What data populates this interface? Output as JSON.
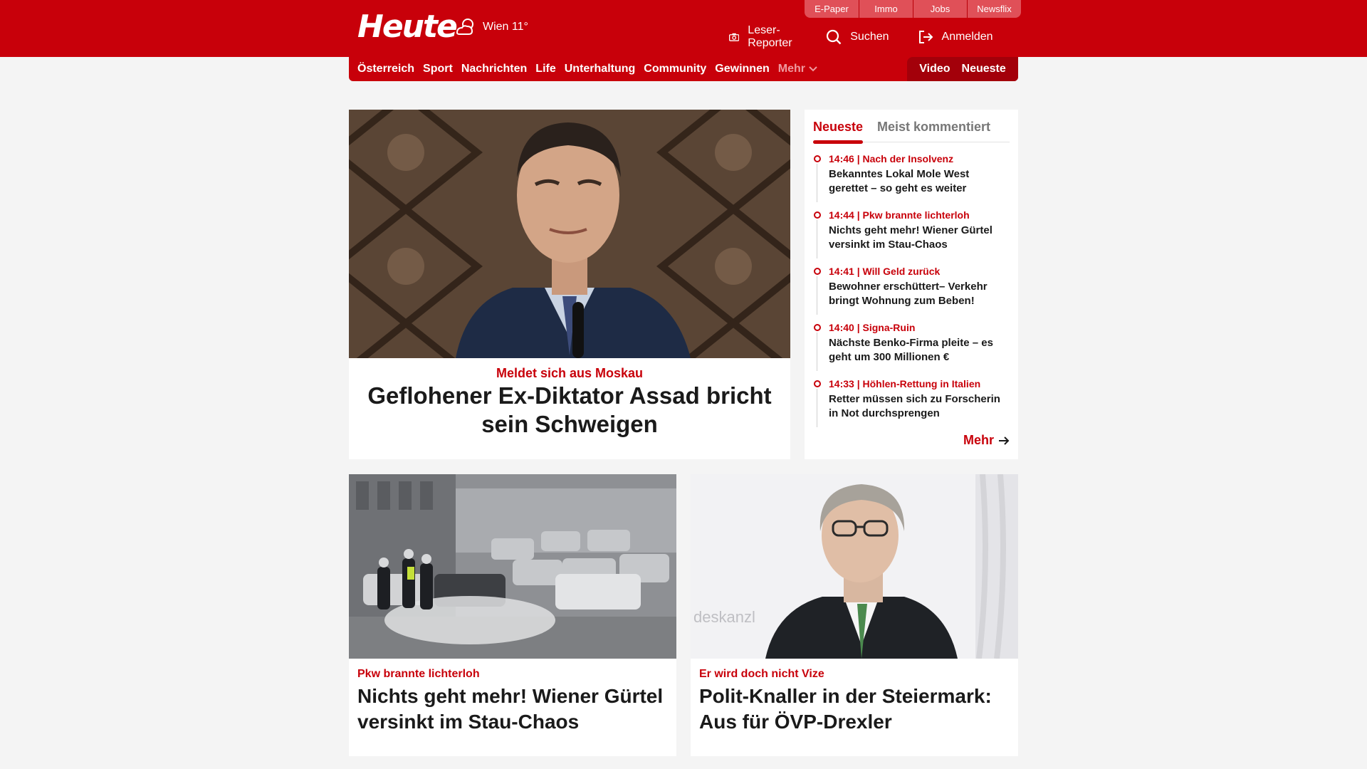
{
  "header": {
    "logo": "Heute",
    "weather": "Wien 11°",
    "top_tabs": [
      "E-Paper",
      "Immo",
      "Jobs",
      "Newsflix"
    ],
    "actions": {
      "reporter": "Leser-Reporter",
      "search": "Suchen",
      "login": "Anmelden"
    }
  },
  "nav": {
    "items": [
      "Österreich",
      "Sport",
      "Nachrichten",
      "Life",
      "Unterhaltung",
      "Community",
      "Gewinnen"
    ],
    "more": "Mehr",
    "video": "Video",
    "latest": "Neueste"
  },
  "hero": {
    "kicker": "Meldet sich aus Moskau",
    "title": "Geflohener Ex-Diktator Assad bricht sein Schweigen"
  },
  "sidebar": {
    "tab_active": "Neueste",
    "tab_inactive": "Meist kommentiert",
    "items": [
      {
        "meta": "14:46 | Nach der Insolvenz",
        "title": "Bekanntes Lokal Mole West gerettet – so geht es weiter"
      },
      {
        "meta": "14:44 | Pkw brannte lichterloh",
        "title": "Nichts geht mehr! Wiener Gürtel versinkt im Stau-Chaos"
      },
      {
        "meta": "14:41 | Will Geld zurück",
        "title": "Bewohner erschüttert– Verkehr bringt Wohnung zum Beben!"
      },
      {
        "meta": "14:40 | Signa-Ruin",
        "title": "Nächste Benko-Firma pleite – es geht um 300 Millionen €"
      },
      {
        "meta": "14:33 | Höhlen-Rettung in Italien",
        "title": "Retter müssen sich zu Forscherin in Not durchsprengen"
      }
    ],
    "more": "Mehr"
  },
  "cards": [
    {
      "kicker": "Pkw brannte lichterloh",
      "title": "Nichts geht mehr! Wiener Gürtel versinkt im Stau-Chaos"
    },
    {
      "kicker": "Er wird doch nicht Vize",
      "title": "Polit-Knaller in der Steiermark: Aus für ÖVP-Drexler",
      "watermark": "deskanzl"
    }
  ],
  "colors": {
    "brand": "#c8000a",
    "background": "#f4f4f4"
  }
}
